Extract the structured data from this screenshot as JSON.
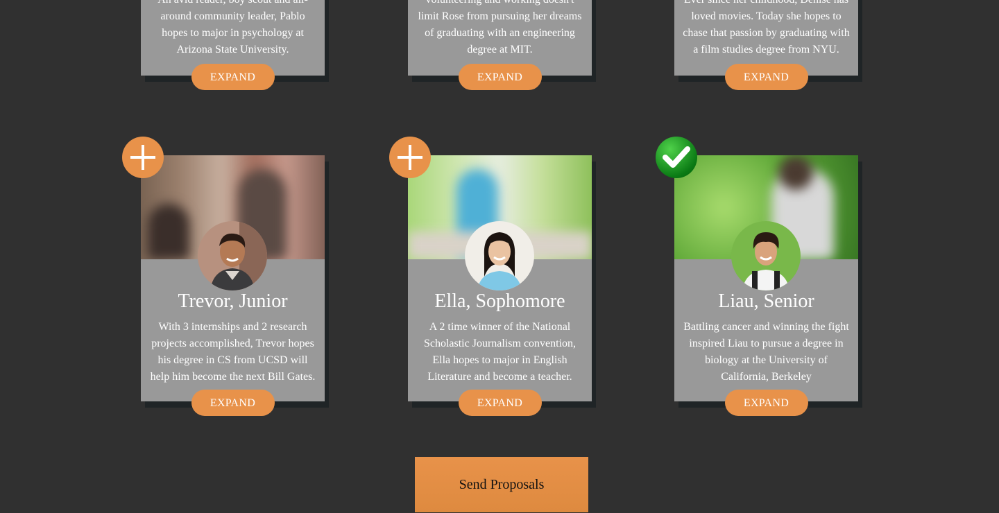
{
  "top_cards": [
    {
      "description": "An avid reader, boy scout and all-around community leader, Pablo hopes to major in psychology at Arizona State University.",
      "expand_label": "EXPAND"
    },
    {
      "description": "volunteering and working doesn't limit Rose from pursuing her dreams of graduating with an engineering degree at MIT.",
      "expand_label": "EXPAND"
    },
    {
      "description": "Ever since her childhood, Denise has loved movies. Today she hopes to chase that passion by graduating with a film studies degree from NYU.",
      "expand_label": "EXPAND"
    }
  ],
  "students": [
    {
      "name": "Trevor, Junior",
      "description": "With 3 internships and 2 research projects accomplished, Trevor hopes his degree in CS from UCSD will help him become the next Bill Gates.",
      "expand_label": "EXPAND",
      "status_icon": "plus-icon",
      "selected": false
    },
    {
      "name": "Ella, Sophomore",
      "description": "A 2 time winner of the National Scholastic Journalism convention, Ella hopes to major in English Literature and become a teacher.",
      "expand_label": "EXPAND",
      "status_icon": "plus-icon",
      "selected": false
    },
    {
      "name": "Liau, Senior",
      "description": "Battling cancer and winning the fight inspired Liau to pursue a degree in biology at the University of California, Berkeley",
      "expand_label": "EXPAND",
      "status_icon": "checkmark-icon",
      "selected": true
    }
  ],
  "send_button_label": "Send Proposals",
  "colors": {
    "background": "#303030",
    "card": "#999999",
    "accent": "#e8924a",
    "selected": "#0a7a14"
  }
}
